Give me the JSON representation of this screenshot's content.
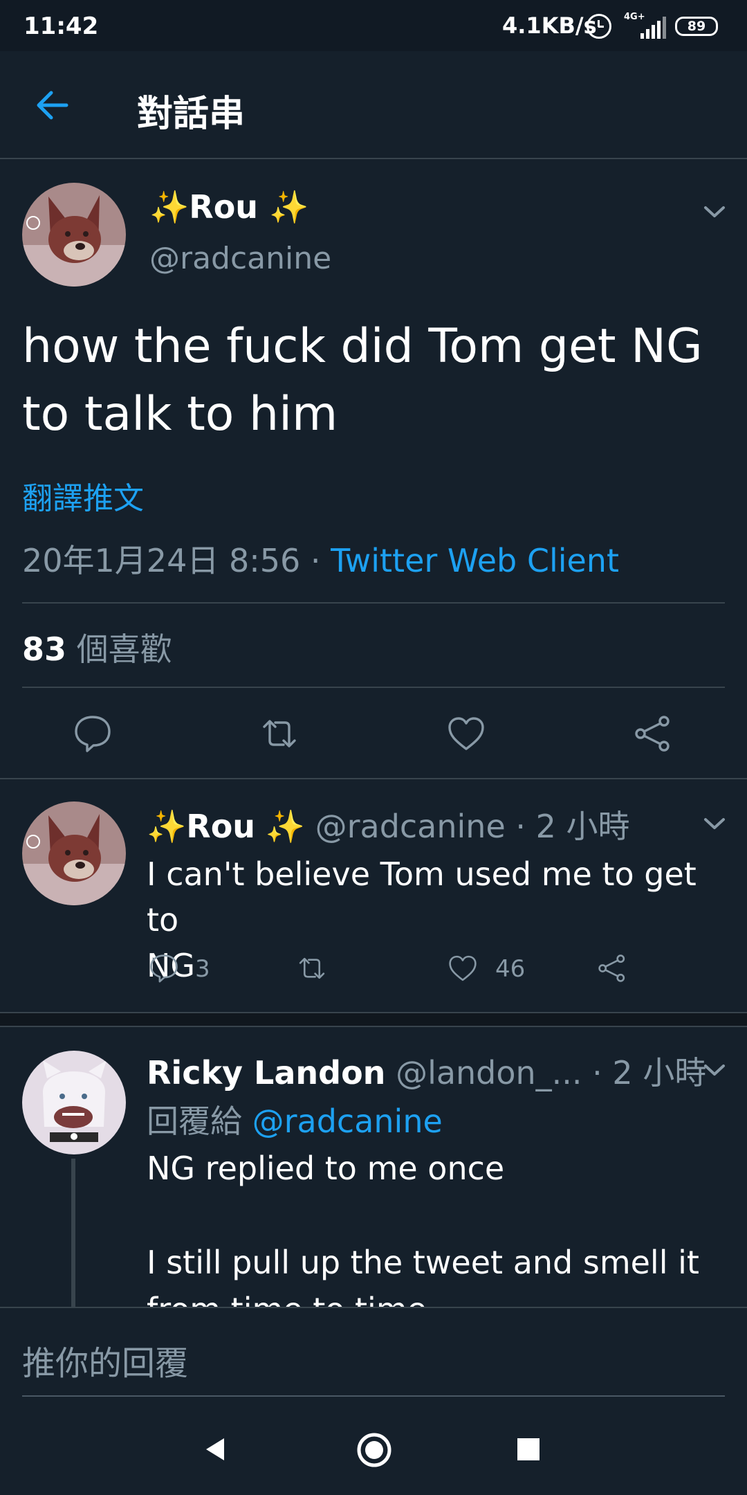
{
  "status_bar": {
    "time": "11:42",
    "net_speed": "4.1KB/s",
    "net_type": "4G+",
    "battery": "89"
  },
  "header": {
    "title": "對話串"
  },
  "main_tweet": {
    "display_name": "Rou",
    "handle": "@radcanine",
    "text_line1": "how the fuck did Tom get NG",
    "text_line2": "to talk to him",
    "translate": "翻譯推文",
    "date": "20年1月24日 8:56 · ",
    "client": "Twitter Web Client",
    "likes_count": "83",
    "likes_label": " 個喜歡"
  },
  "reply1": {
    "display_name": "Rou",
    "handle_time": "@radcanine · 2 小時",
    "text_line1": "I can't believe Tom used me to get to",
    "text_line2": "NG",
    "reply_count": "3",
    "like_count": "46"
  },
  "reply2": {
    "display_name": "Ricky Landon",
    "handle": "@landon_...",
    "time": " · 2 小時",
    "replying_to_label": "回覆給 ",
    "replying_to": "@radcanine",
    "text_line1": "NG replied to me once",
    "text_line2": "I still pull up the tweet and smell it",
    "text_line3": "from time to time"
  },
  "composer": {
    "placeholder": "推你的回覆"
  },
  "colors": {
    "background": "#15202b",
    "accent": "#1da1f2",
    "muted": "#8899a6",
    "divider": "#38444d"
  }
}
